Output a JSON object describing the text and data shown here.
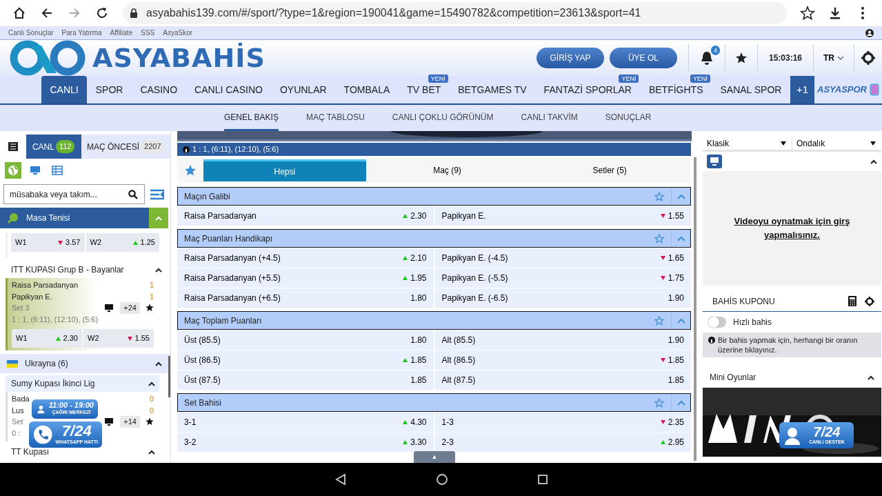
{
  "browser": {
    "url": "asyabahis139.com/#/sport/?type=1&region=190041&game=15490782&competition=23613&sport=41"
  },
  "top_links": [
    "Canlı Sonuçlar",
    "Para Yatırma",
    "Affiliate",
    "SSS",
    "AsyaSkor"
  ],
  "header": {
    "logo": "ASYABAHİS",
    "login": "GİRİŞ YAP",
    "register": "ÜYE OL",
    "notifications": "4",
    "time": "15:03:16",
    "language": "TR"
  },
  "main_nav": [
    {
      "label": "CANLI",
      "selected": true
    },
    {
      "label": "SPOR",
      "selected": false
    },
    {
      "label": "CASINO",
      "selected": false
    },
    {
      "label": "CANLI CASINO",
      "selected": false
    },
    {
      "label": "OYUNLAR",
      "selected": false
    },
    {
      "label": "TOMBALA",
      "selected": false
    },
    {
      "label": "TV BET",
      "selected": false,
      "badge": "YENİ"
    },
    {
      "label": "BETGAMES TV",
      "selected": false
    },
    {
      "label": "FANTAZİ SPORLAR",
      "selected": false,
      "badge": "YENİ"
    },
    {
      "label": "BETFİGHTS",
      "selected": false,
      "badge": "YENİ"
    },
    {
      "label": "SANAL SPOR",
      "selected": false
    }
  ],
  "nav_more": "+1",
  "partner_logo": "ASYASPOR",
  "sub_nav": [
    {
      "label": "GENEL BAKIŞ",
      "selected": true
    },
    {
      "label": "MAÇ TABLOSU",
      "selected": false
    },
    {
      "label": "CANLI ÇOKLU GÖRÜNÜM",
      "selected": false
    },
    {
      "label": "CANLI TAKVİM",
      "selected": false
    },
    {
      "label": "SONUÇLAR",
      "selected": false
    }
  ],
  "sidebar": {
    "tabs": [
      {
        "label": "CANL",
        "count": "112",
        "selected": true
      },
      {
        "label": "MAÇ ÖNCESİ",
        "count": "2207",
        "selected": false
      }
    ],
    "view_modes": [
      {
        "kind": "globe",
        "selected": true
      },
      {
        "kind": "monitor",
        "selected": false
      },
      {
        "kind": "table",
        "selected": false
      }
    ],
    "search": {
      "placeholder": "müsabaka veya takım..."
    },
    "sport": {
      "name": "Masa Tenisi",
      "expanded": true
    },
    "odds": [
      {
        "label": "W1",
        "odd": "3.57",
        "kind": "down"
      },
      {
        "label": "W2",
        "odd": "1.25",
        "kind": "up"
      }
    ],
    "competitions": [
      {
        "name": "ITT KUPASI Grup B - Bayanlar",
        "expanded": true,
        "matches": [
          {
            "team1": "Raisa Parsadanyan",
            "team2": "Papikyan E.",
            "score1": "1",
            "score2": "1",
            "period": "Set 3",
            "detail": "1 : 1, (6:11), (12:10), (5:6)",
            "more": "+24",
            "selected": true,
            "odds": [
              {
                "label": "W1",
                "odd": "2.30",
                "kind": "up"
              },
              {
                "label": "W2",
                "odd": "1.55",
                "kind": "down"
              }
            ]
          }
        ]
      }
    ],
    "region": {
      "name": "Ukrayna (6)",
      "expanded": true,
      "competitions": [
        {
          "name": "Sumy Kupası İkinci Lig",
          "expanded": true,
          "matches": [
            {
              "team1": "Bada",
              "team2": "Lus",
              "score1": "0",
              "score2": "0",
              "period": "Set",
              "detail": "0 :",
              "more": "+14",
              "selected": false
            }
          ]
        },
        {
          "name": "TT Kupası",
          "expanded": true
        }
      ]
    }
  },
  "game": {
    "score_bar": "1 : 1, (6:11), (12:10), (5:6)",
    "tabs": [
      {
        "label": "Hepsi",
        "selected": true
      },
      {
        "label": "Maç (9)",
        "selected": false
      },
      {
        "label": "Setler (5)",
        "selected": false
      }
    ],
    "markets": [
      {
        "title": "Maçın Galibi",
        "expanded": true,
        "rows": [
          [
            {
              "name": "Raisa Parsadanyan",
              "odd": "2.30",
              "kind": "up"
            },
            {
              "name": "Papikyan E.",
              "odd": "1.55",
              "kind": "down"
            }
          ]
        ]
      },
      {
        "title": "Maç Puanları Handikapı",
        "expanded": true,
        "rows": [
          [
            {
              "name": "Raisa Parsadanyan (+4.5)",
              "odd": "2.10",
              "kind": "up"
            },
            {
              "name": "Papikyan E. (-4.5)",
              "odd": "1.65",
              "kind": "down"
            }
          ],
          [
            {
              "name": "Raisa Parsadanyan (+5.5)",
              "odd": "1.95",
              "kind": "up"
            },
            {
              "name": "Papikyan E. (-5.5)",
              "odd": "1.75",
              "kind": "down"
            }
          ],
          [
            {
              "name": "Raisa Parsadanyan (+6.5)",
              "odd": "1.80",
              "kind": "plain"
            },
            {
              "name": "Papikyan E. (-6.5)",
              "odd": "1.90",
              "kind": "plain"
            }
          ]
        ]
      },
      {
        "title": "Maç Toplam Puanları",
        "expanded": true,
        "rows": [
          [
            {
              "name": "Üst (85.5)",
              "odd": "1.80",
              "kind": "plain"
            },
            {
              "name": "Alt (85.5)",
              "odd": "1.90",
              "kind": "plain"
            }
          ],
          [
            {
              "name": "Üst (86.5)",
              "odd": "1.85",
              "kind": "up"
            },
            {
              "name": "Alt (86.5)",
              "odd": "1.85",
              "kind": "down"
            }
          ],
          [
            {
              "name": "Üst (87.5)",
              "odd": "1.85",
              "kind": "plain"
            },
            {
              "name": "Alt (87.5)",
              "odd": "1.85",
              "kind": "plain"
            }
          ]
        ]
      },
      {
        "title": "Set Bahisi",
        "expanded": true,
        "rows": [
          [
            {
              "name": "3-1",
              "odd": "4.30",
              "kind": "up"
            },
            {
              "name": "1-3",
              "odd": "2.35",
              "kind": "down"
            }
          ],
          [
            {
              "name": "3-2",
              "odd": "3.30",
              "kind": "up"
            },
            {
              "name": "2-3",
              "odd": "2.95",
              "kind": "up"
            }
          ]
        ]
      }
    ],
    "scroll_top": "▲"
  },
  "right": {
    "odds_type": "Klasik",
    "odds_format": "Ondalık",
    "video": {
      "expanded": true,
      "message": "Videoyu oynatmak için girş yapmalısınız."
    },
    "betslip": {
      "title": "BAHİS KUPONU",
      "quick_bet": {
        "label": "Hızlı bahis",
        "on": false
      },
      "info": "Bir bahis yapmak için, herhangi bir oranın üzerine tıklayınız."
    },
    "mini_games": {
      "title": "Mini Oyunlar",
      "expanded": true
    }
  },
  "floating": {
    "call_center": {
      "hours": "11:00 - 19:00",
      "label": "ÇAĞRI MERKEZİ"
    },
    "whatsapp": {
      "hours": "7/24",
      "label": "WHATSAPP HATTI"
    },
    "live_support": {
      "hours": "7/24",
      "label": "CANLI DESTEK"
    }
  }
}
